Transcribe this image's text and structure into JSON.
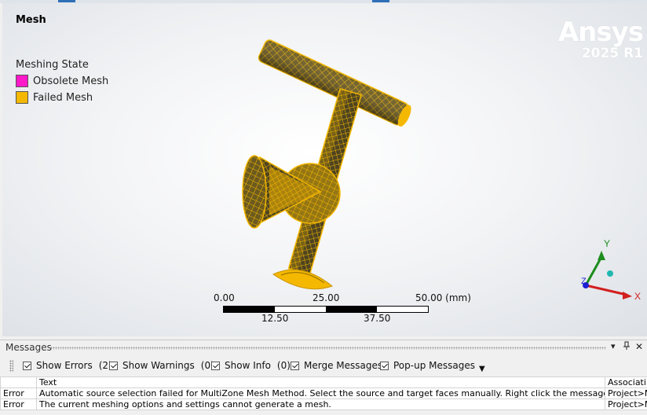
{
  "viewport": {
    "title": "Mesh",
    "legend": {
      "title": "Meshing State",
      "items": [
        {
          "label": "Obsolete Mesh",
          "color": "#ff19c8"
        },
        {
          "label": "Failed Mesh",
          "color": "#f5b800"
        }
      ]
    },
    "brand": {
      "name": "Ansys",
      "version": "2025 R1"
    },
    "mesh_color": "#f5b800",
    "scale": {
      "top_labels": [
        "0.00",
        "25.00",
        "50.00 (mm)"
      ],
      "bottom_labels": [
        "12.50",
        "37.50"
      ]
    },
    "triad": {
      "x": "X",
      "y": "Y",
      "z": "Z",
      "x_color": "#d21e1e",
      "y_color": "#1e8c1e",
      "z_color": "#1e1ed2"
    }
  },
  "messages": {
    "title": "Messages",
    "header_buttons": {
      "dropdown": "▾",
      "pin": "⬆",
      "close": "✕"
    },
    "toolbar": {
      "show_errors": "Show Errors",
      "errors_count": "(2)",
      "show_warnings": "Show Warnings",
      "warnings_count": "(0)",
      "show_info": "Show Info",
      "info_count": "(0)",
      "merge": "Merge Messages",
      "popup": "Pop-up Messages"
    },
    "columns": [
      "",
      "Text",
      "Associati"
    ],
    "rows": [
      {
        "type": "Error",
        "text": "Automatic source selection failed for MultiZone Mesh Method. Select the source and target faces manually. Right click the message and clic",
        "assoc": "Project>M"
      },
      {
        "type": "Error",
        "text": "The current meshing options and settings cannot generate a mesh.",
        "assoc": "Project>M"
      }
    ]
  }
}
